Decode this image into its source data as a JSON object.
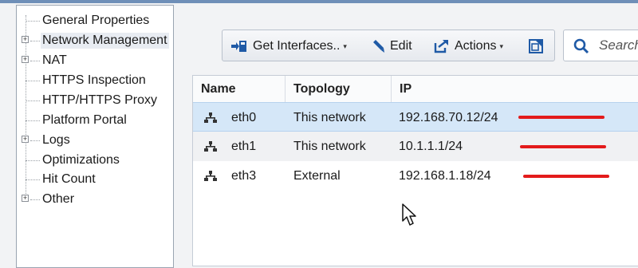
{
  "tree": {
    "items": [
      {
        "label": "General Properties",
        "expandable": false
      },
      {
        "label": "Network Management",
        "expandable": true,
        "selected": true
      },
      {
        "label": "NAT",
        "expandable": true
      },
      {
        "label": "HTTPS Inspection",
        "expandable": false
      },
      {
        "label": "HTTP/HTTPS Proxy",
        "expandable": false
      },
      {
        "label": "Platform Portal",
        "expandable": false
      },
      {
        "label": "Logs",
        "expandable": true
      },
      {
        "label": "Optimizations",
        "expandable": false
      },
      {
        "label": "Hit Count",
        "expandable": false
      },
      {
        "label": "Other",
        "expandable": true
      }
    ],
    "expand_glyph": "+"
  },
  "toolbar": {
    "get_interfaces_label": "Get Interfaces..",
    "edit_label": "Edit",
    "actions_label": "Actions",
    "caret": "▾"
  },
  "search": {
    "placeholder": "Search"
  },
  "table": {
    "columns": [
      "Name",
      "Topology",
      "IP"
    ],
    "rows": [
      {
        "name": "eth0",
        "topology": "This network",
        "ip": "192.168.70.12/24"
      },
      {
        "name": "eth1",
        "topology": "This network",
        "ip": "10.1.1.1/24"
      },
      {
        "name": "eth3",
        "topology": "External",
        "ip": "192.168.1.18/24"
      }
    ],
    "selected_row": 0
  },
  "colors": {
    "accent_selected": "#d5e7f8",
    "redaction": "#e31b1b",
    "icon_blue": "#1f5aa6"
  }
}
